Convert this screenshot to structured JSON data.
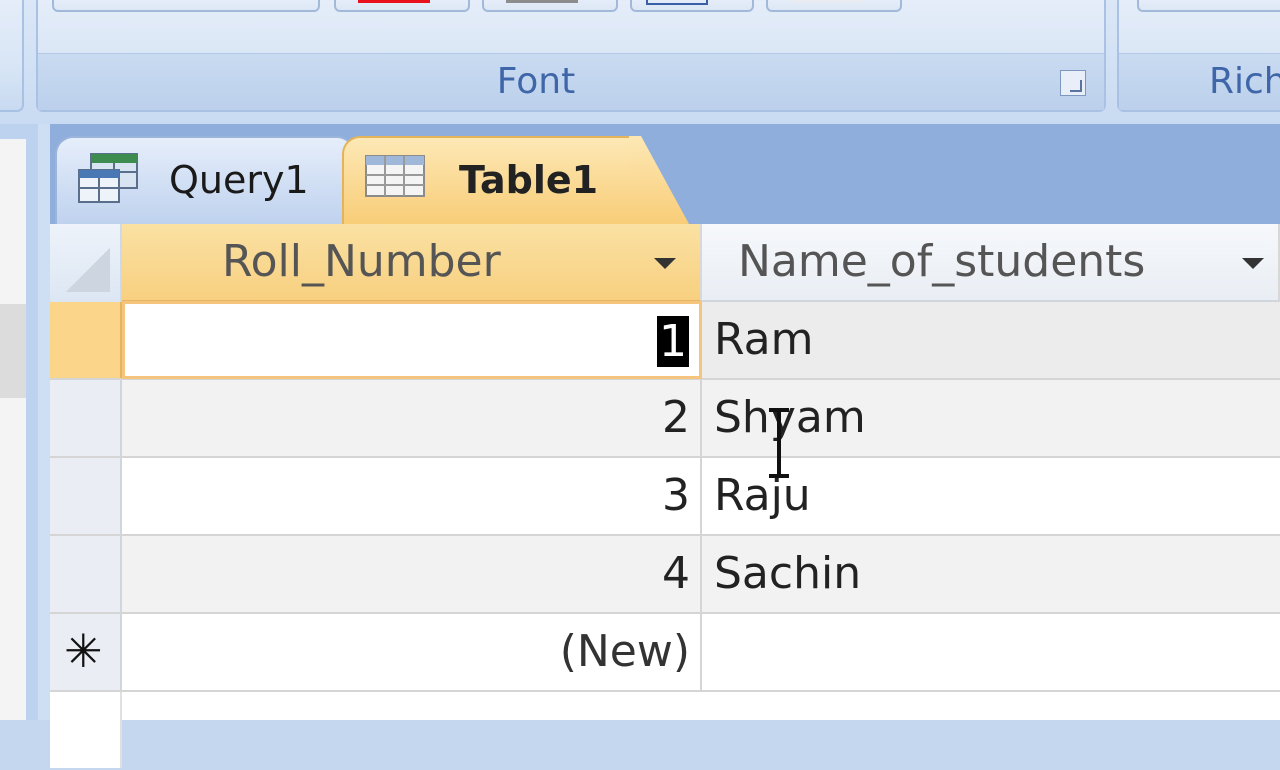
{
  "ribbon": {
    "groups": {
      "font_label": "Font",
      "rich_label": "Rich"
    }
  },
  "tabs": [
    {
      "label": "Query1",
      "icon": "query-icon",
      "active": false
    },
    {
      "label": "Table1",
      "icon": "table-icon",
      "active": true
    }
  ],
  "grid": {
    "columns": [
      "Roll_Number",
      "Name_of_students"
    ],
    "rows": [
      {
        "roll": "1",
        "name": "Ram"
      },
      {
        "roll": "2",
        "name": "Shyam"
      },
      {
        "roll": "3",
        "name": "Raju"
      },
      {
        "roll": "4",
        "name": "Sachin"
      }
    ],
    "new_row_label": "(New)",
    "new_row_marker": "✳"
  },
  "colors": {
    "active_tab": "#f8cd78",
    "ribbon_label": "#3f66a8",
    "tabbar": "#8faedc"
  }
}
